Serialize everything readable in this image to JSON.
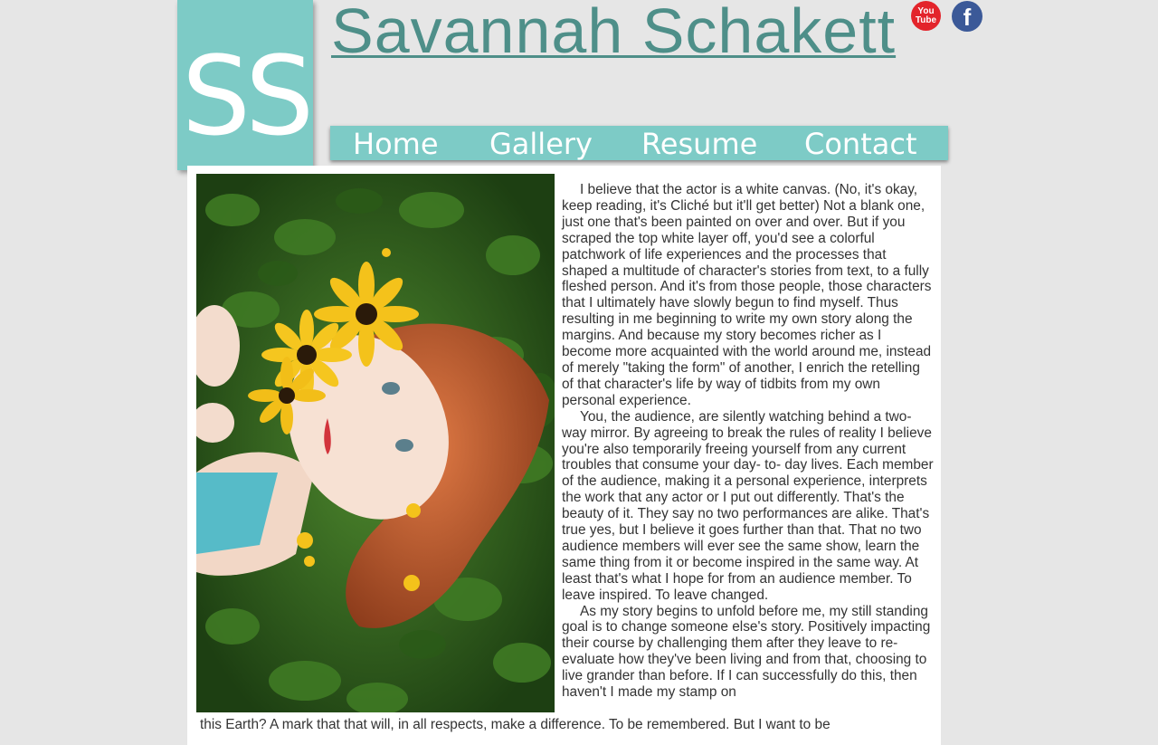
{
  "site": {
    "logo_text": "SS",
    "title": "Savannah Schakett"
  },
  "social": {
    "youtube_label": "You Tube",
    "facebook_label": "f"
  },
  "nav": {
    "items": [
      "Home",
      "Gallery",
      "Resume",
      "Contact"
    ]
  },
  "main": {
    "paragraphs": [
      "I believe that the actor is a white canvas. (No, it's okay, keep reading, it's Cliché but it'll get better) Not a blank one, just one that's been painted on over and over. But if you scraped the top white layer off, you'd see a colorful patchwork of life experiences and the processes that shaped a multitude of character's stories from text, to a fully fleshed person. And it's from those people, those characters that I ultimately have slowly begun to find myself. Thus resulting in me beginning to write my own story along the margins. And because my story becomes richer as I become more acquainted with the world around me, instead of merely \"taking the form\" of another, I enrich the retelling of that character's life by way of tidbits from my own personal experience.",
      "You, the audience, are silently watching behind a two-way mirror. By agreeing to break the rules of reality I believe you're also temporarily freeing yourself from any current troubles that consume your day- to- day lives. Each member of the audience, making it a personal experience, interprets the work that any actor or I put out differently. That's the beauty of it. They say no two performances are alike. That's true yes, but I believe it goes further than that. That no two audience members will ever see the same show, learn the same thing from it or become inspired in the same way. At least that's what I hope for from an audience member. To leave inspired. To leave changed.",
      "As my story begins to unfold before me, my still standing goal is to change someone else's story. Positively impacting their course by challenging them after they leave to re-evaluate how they've been living and from that, choosing to live grander than before. If I can successfully do this, then haven't I made my stamp on"
    ],
    "tail_text": "this Earth? A mark that that will, in all respects, make a difference. To be remembered. But I want to be"
  },
  "colors": {
    "accent": "#7dcbc6",
    "title": "#4e8f89",
    "background": "#e6e6e6"
  }
}
